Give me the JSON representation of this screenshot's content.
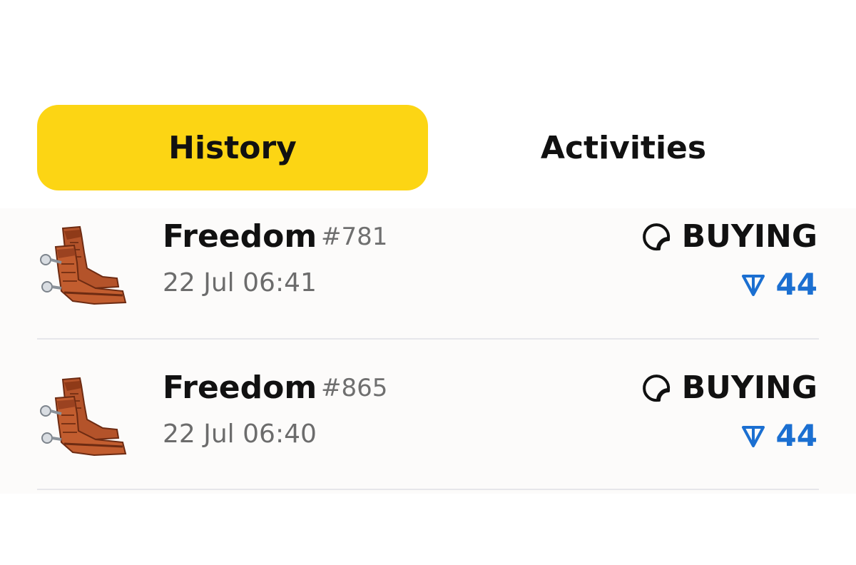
{
  "tabs": [
    {
      "label": "History",
      "active": true
    },
    {
      "label": "Activities",
      "active": false
    }
  ],
  "items": [
    {
      "name": "Freedom",
      "number": "#781",
      "date": "22 Jul 06:41",
      "status": "BUYING",
      "price": "44",
      "icon": "cowboy-boots-icon"
    },
    {
      "name": "Freedom",
      "number": "#865",
      "date": "22 Jul 06:40",
      "status": "BUYING",
      "price": "44",
      "icon": "cowboy-boots-icon"
    }
  ],
  "colors": {
    "accent": "#fcd514",
    "price": "#1b6fd1",
    "text": "#111111",
    "muted": "#6c6c6c"
  }
}
